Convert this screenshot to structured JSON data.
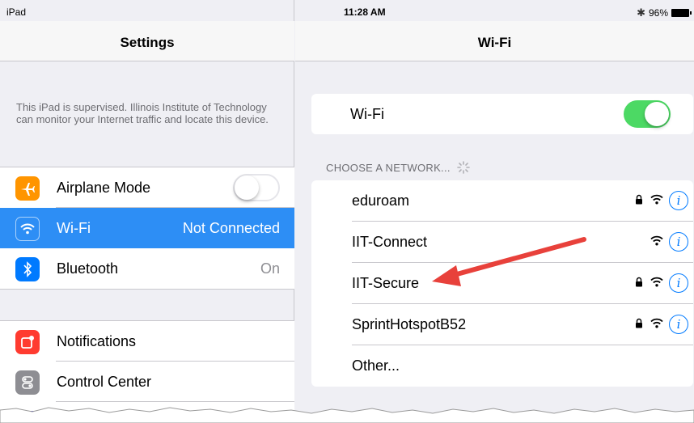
{
  "status_bar": {
    "device": "iPad",
    "time": "11:28 AM",
    "battery": "96%"
  },
  "settings": {
    "title": "Settings",
    "supervised_notice": "This iPad is supervised. Illinois Institute of Technology can monitor your Internet traffic and locate this device.",
    "items": [
      {
        "label": "Airplane Mode",
        "value": "",
        "icon": "airplane-icon",
        "icon_color": "#ff9500",
        "toggle": "off"
      },
      {
        "label": "Wi-Fi",
        "value": "Not Connected",
        "icon": "wifi-icon",
        "icon_color": "#2d8ef5",
        "selected": true
      },
      {
        "label": "Bluetooth",
        "value": "On",
        "icon": "bluetooth-icon",
        "icon_color": "#007aff"
      }
    ],
    "items2": [
      {
        "label": "Notifications",
        "icon": "notifications-icon",
        "icon_color": "#ff3b30"
      },
      {
        "label": "Control Center",
        "icon": "control-center-icon",
        "icon_color": "#8e8e93"
      }
    ]
  },
  "wifi": {
    "title": "Wi-Fi",
    "toggle_label": "Wi-Fi",
    "toggle_state": "on",
    "section_header": "CHOOSE A NETWORK...",
    "networks": [
      {
        "name": "eduroam",
        "locked": true
      },
      {
        "name": "IIT-Connect",
        "locked": false
      },
      {
        "name": "IIT-Secure",
        "locked": true
      },
      {
        "name": "SprintHotspotB52",
        "locked": true
      }
    ],
    "other": "Other..."
  },
  "colors": {
    "accent": "#007aff",
    "selected": "#2d8ef5",
    "toggle_on": "#4cd964",
    "arrow": "#e8413b"
  }
}
